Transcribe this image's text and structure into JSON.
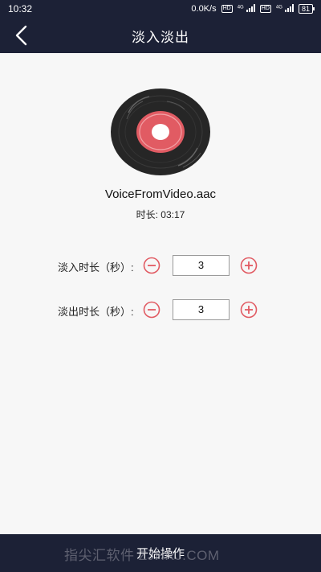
{
  "status": {
    "time": "10:32",
    "speed": "0.0K/s",
    "hd1": "HD",
    "net1": "4G",
    "hd2": "HD",
    "net2": "4G",
    "battery": "81"
  },
  "header": {
    "title": "淡入淡出"
  },
  "media": {
    "filename": "VoiceFromVideo.aac",
    "duration": "时长: 03:17"
  },
  "fade_in": {
    "label": "淡入时长（秒）:",
    "value": "3"
  },
  "fade_out": {
    "label": "淡出时长（秒）:",
    "value": "3"
  },
  "footer": {
    "start_label": "开始操作"
  },
  "watermark": "指尖汇软件 ZJHRJ.COM",
  "colors": {
    "bar": "#1c2136",
    "accent": "#e15b63",
    "disc": "#262626"
  }
}
